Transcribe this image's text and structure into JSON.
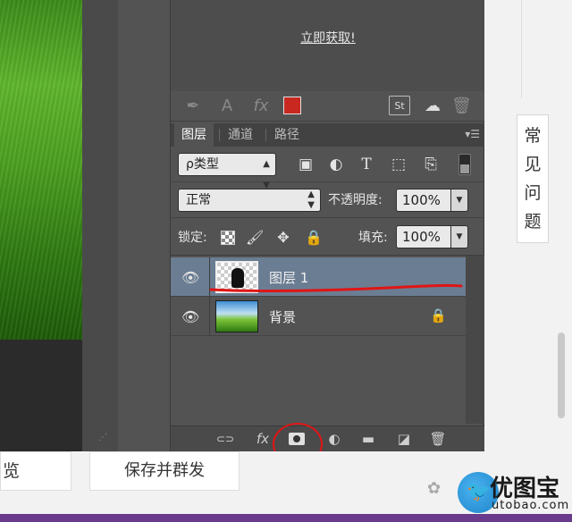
{
  "colors": {
    "swatch": "#c8281f",
    "selected_row": "#6b7d92",
    "annotation": "#e01515"
  },
  "creative_cloud": {
    "link_label": "立即获取!"
  },
  "library_toolbar": {
    "icons": [
      "brush-icon",
      "text-icon",
      "fx-icon",
      "color-swatch",
      "stock-icon",
      "cloud-sync-icon",
      "trash-icon"
    ],
    "text_glyph": "A",
    "fx_glyph": "fx",
    "stock_glyph": "St"
  },
  "tabs": [
    {
      "label": "图层",
      "active": true
    },
    {
      "label": "通道",
      "active": false
    },
    {
      "label": "路径",
      "active": false
    }
  ],
  "filter": {
    "kind_label": "ρ类型"
  },
  "blend": {
    "mode": "正常",
    "opacity_label": "不透明度:",
    "opacity_value": "100%",
    "lock_label": "锁定:",
    "fill_label": "填充:",
    "fill_value": "100%"
  },
  "layers": [
    {
      "name": "图层 1",
      "selected": true,
      "locked": false
    },
    {
      "name": "背景",
      "selected": false,
      "locked": true
    }
  ],
  "bottom_icons": [
    "link-icon",
    "fx-icon",
    "add-mask-icon",
    "adjustment-icon",
    "folder-icon",
    "new-layer-icon",
    "trash-icon"
  ],
  "bottom_glyphs": {
    "link": "⊂⊃",
    "fx": "fx",
    "adjust": "◐",
    "folder": "▬",
    "new_layer": "◪",
    "trash": "🗑"
  },
  "web": {
    "faq_chars": [
      "常",
      "见",
      "问",
      "题"
    ],
    "preview_label": "览",
    "send_label": "保存并群发"
  },
  "watermark": {
    "text": "优图宝",
    "url": "utobao.com"
  }
}
